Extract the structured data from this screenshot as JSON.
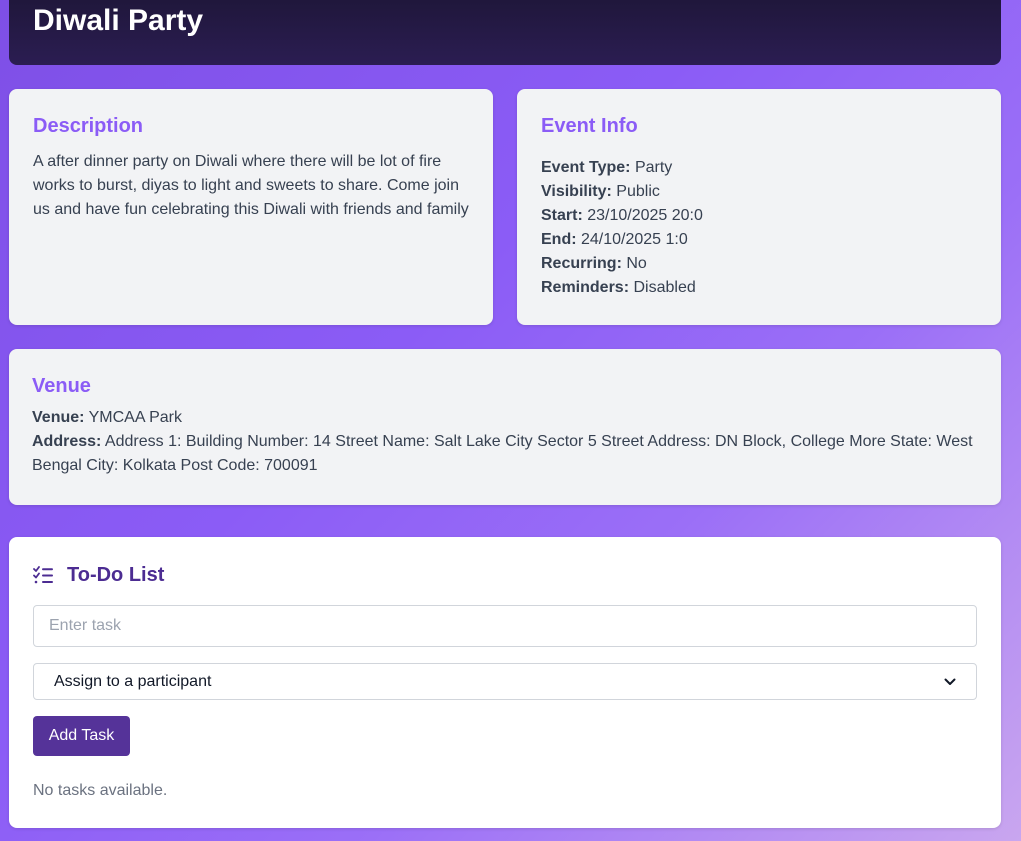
{
  "header": {
    "title": "Diwali Party"
  },
  "description": {
    "heading": "Description",
    "text": "A after dinner party on Diwali where there will be lot of fire works to burst, diyas to light and sweets to share. Come join us and have fun celebrating this Diwali with friends and family"
  },
  "event_info": {
    "heading": "Event Info",
    "items": [
      {
        "label": "Event Type:",
        "value": "Party"
      },
      {
        "label": "Visibility:",
        "value": "Public"
      },
      {
        "label": "Start:",
        "value": "23/10/2025 20:0"
      },
      {
        "label": "End:",
        "value": "24/10/2025 1:0"
      },
      {
        "label": "Recurring:",
        "value": "No"
      },
      {
        "label": "Reminders:",
        "value": "Disabled"
      }
    ]
  },
  "venue": {
    "heading": "Venue",
    "venue_label": "Venue:",
    "venue_value": "YMCAA Park",
    "address_label": "Address:",
    "address_value": "Address 1: Building Number: 14 Street Name: Salt Lake City Sector 5 Street Address: DN Block, College More State: West Bengal City: Kolkata Post Code: 700091"
  },
  "todo": {
    "heading": "To-Do List",
    "icon": "list-check-icon",
    "task_placeholder": "Enter task",
    "assign_selected": "Assign to a participant",
    "add_button": "Add Task",
    "empty_text": "No tasks available."
  },
  "colors": {
    "accent": "#8b5cf6",
    "todo_heading": "#4c2c92",
    "button": "#553399",
    "header_bg": "#1e1638"
  }
}
